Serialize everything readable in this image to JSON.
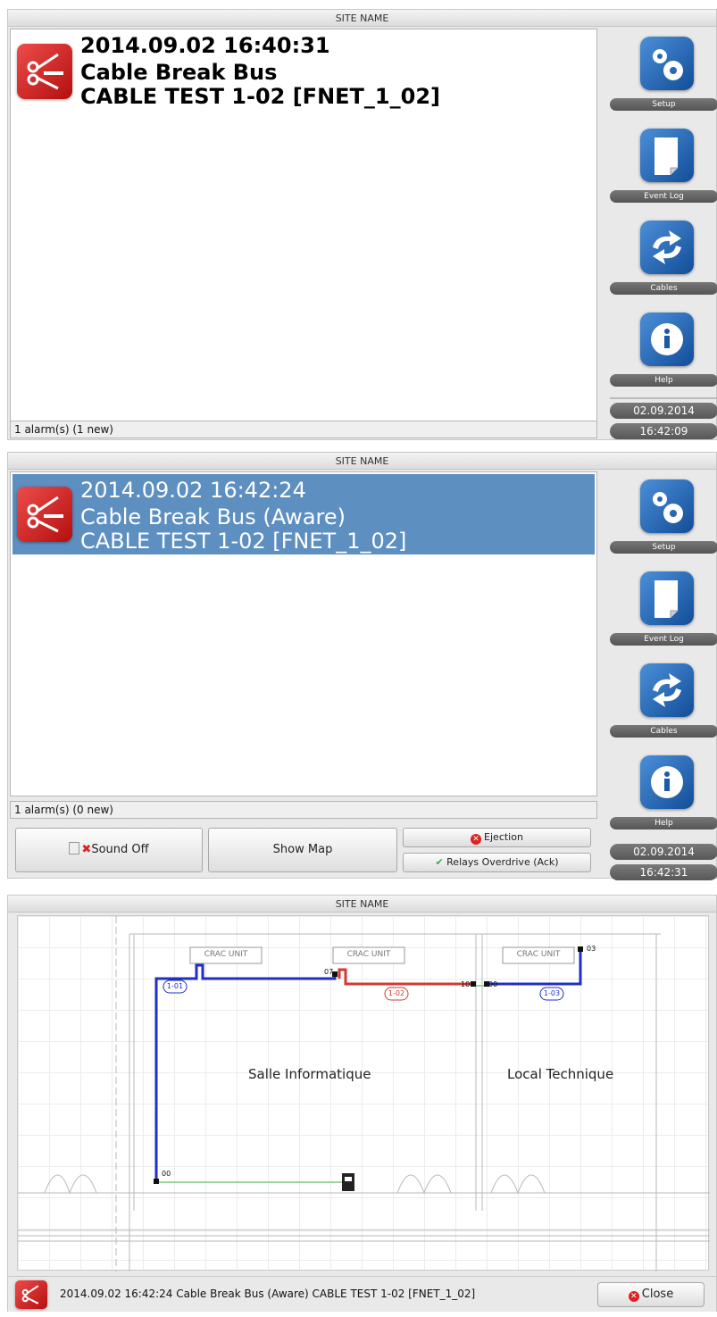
{
  "site_name": "SITE NAME",
  "screen1": {
    "alarm_lines": [
      "2014.09.02 16:40:31",
      "Cable Break Bus",
      "CABLE TEST 1-02 [FNET_1_02]"
    ],
    "status": "1 alarm(s) (1 new)",
    "date": "02.09.2014",
    "time": "16:42:09"
  },
  "screen2": {
    "alarm_lines": [
      "2014.09.02 16:42:24",
      "Cable Break Bus (Aware)",
      "CABLE TEST 1-02 [FNET_1_02]"
    ],
    "status": "1 alarm(s) (0 new)",
    "date": "02.09.2014",
    "time": "16:42:31",
    "sound_off": "Sound Off",
    "show_map": "Show Map",
    "ejection": "Ejection",
    "relays": "Relays Overdrive (Ack)"
  },
  "sidebar": {
    "setup": "Setup",
    "event_log": "Event Log",
    "cables": "Cables",
    "help": "Help"
  },
  "map": {
    "crac_labels": [
      "CRAC UNIT",
      "CRAC UNIT",
      "CRAC UNIT"
    ],
    "rooms": [
      "Salle Informatique",
      "Local Technique"
    ],
    "cable_labels": [
      "1-01",
      "1-02",
      "1-03"
    ],
    "node_labels": [
      "00",
      "07",
      "10",
      "00",
      "03",
      "00"
    ]
  },
  "footer": {
    "text": "2014.09.02 16:42:24  Cable Break Bus (Aware) CABLE TEST 1-02 [FNET_1_02]",
    "close": "Close"
  },
  "colors": {
    "blue_cable": "#1f2fc4",
    "red_cable": "#d43a30",
    "green_cable": "#9bd79b",
    "selection": "#5d8fc0"
  }
}
